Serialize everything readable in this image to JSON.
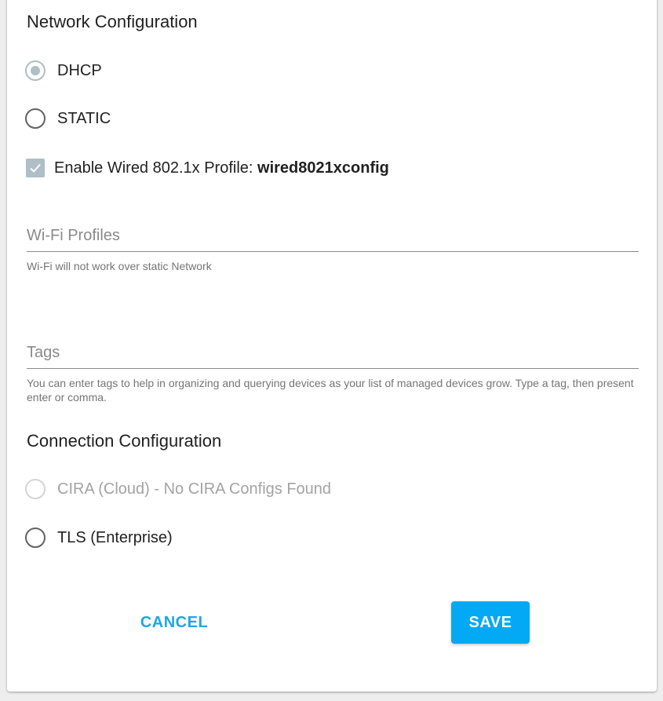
{
  "network": {
    "title": "Network Configuration",
    "dhcp_label": "DHCP",
    "static_label": "STATIC",
    "selected": "DHCP",
    "wired_profile": {
      "checked": true,
      "label_prefix": "Enable Wired 802.1x Profile: ",
      "profile_name": "wired8021xconfig"
    }
  },
  "wifi": {
    "placeholder": "Wi-Fi Profiles",
    "hint": "Wi-Fi will not work over static Network"
  },
  "tags": {
    "placeholder": "Tags",
    "hint": "You can enter tags to help in organizing and querying devices as your list of managed devices grow. Type a tag, then present enter or comma."
  },
  "connection": {
    "title": "Connection Configuration",
    "cira_label": "CIRA (Cloud) - No CIRA Configs Found",
    "cira_disabled": true,
    "tls_label": "TLS (Enterprise)"
  },
  "actions": {
    "cancel_label": "CANCEL",
    "save_label": "SAVE"
  },
  "colors": {
    "accent": "#03a9f4",
    "checked_control": "#b0bec5",
    "disabled_text": "#a3a3a3"
  }
}
